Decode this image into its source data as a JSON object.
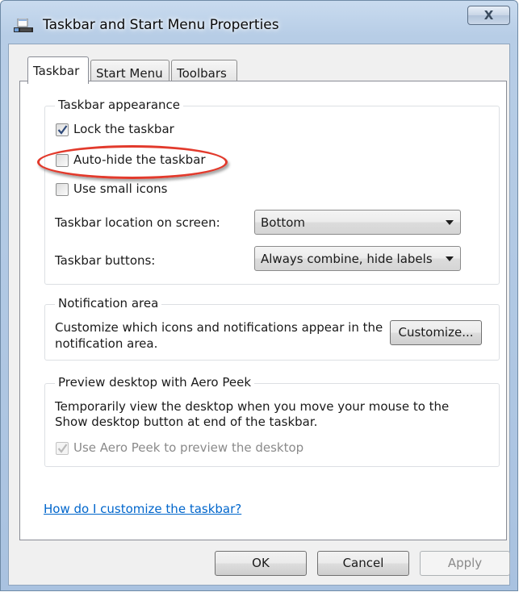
{
  "window": {
    "title": "Taskbar and Start Menu Properties",
    "close_label": "X",
    "app_icon": "taskbar-window-icon"
  },
  "tabs": [
    {
      "label": "Taskbar",
      "active": true
    },
    {
      "label": "Start Menu",
      "active": false
    },
    {
      "label": "Toolbars",
      "active": false
    }
  ],
  "taskbar_appearance": {
    "title": "Taskbar appearance",
    "lock": {
      "label": "Lock the taskbar",
      "checked": true
    },
    "autohide": {
      "label": "Auto-hide the taskbar",
      "checked": false,
      "highlighted": true
    },
    "small_icons": {
      "label": "Use small icons",
      "checked": false
    },
    "location": {
      "label": "Taskbar location on screen:",
      "value": "Bottom"
    },
    "buttons": {
      "label": "Taskbar buttons:",
      "value": "Always combine, hide labels"
    }
  },
  "notification": {
    "title": "Notification area",
    "text_line1": "Customize which icons and notifications appear in the",
    "text_line2": "notification area.",
    "button": "Customize..."
  },
  "aero_peek": {
    "title": "Preview desktop with Aero Peek",
    "text_line1": "Temporarily view the desktop when you move your mouse to the",
    "text_line2": "Show desktop button at end of the taskbar.",
    "checkbox": {
      "label": "Use Aero Peek to preview the desktop",
      "checked": true,
      "enabled": false
    }
  },
  "help_link": "How do I customize the taskbar?",
  "buttons": {
    "ok": "OK",
    "cancel": "Cancel",
    "apply": "Apply"
  },
  "colors": {
    "highlight": "#e23a2c",
    "link": "#0066cc"
  }
}
